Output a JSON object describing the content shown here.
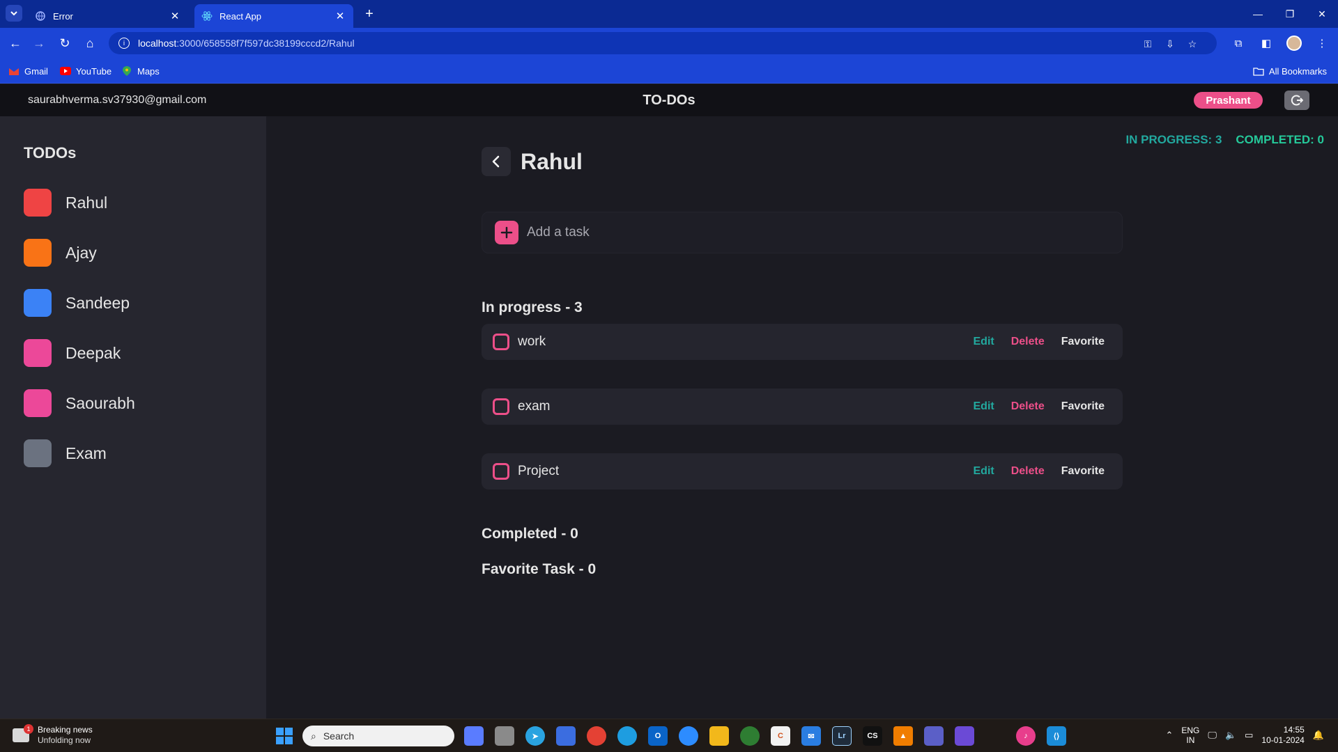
{
  "browser": {
    "tabs": [
      {
        "title": "Error",
        "active": false
      },
      {
        "title": "React App",
        "active": true
      }
    ],
    "url_host": "localhost",
    "url_path": ":3000/658558f7f597dc38199cccd2/Rahul",
    "bookmarks": [
      "Gmail",
      "YouTube",
      "Maps"
    ],
    "all_bookmarks": "All Bookmarks"
  },
  "header": {
    "email": "saurabhverma.sv37930@gmail.com",
    "title": "TO-DOs",
    "user_name": "Prashant"
  },
  "sidebar": {
    "title": "TODOs",
    "items": [
      {
        "label": "Rahul",
        "color": "#ef4444"
      },
      {
        "label": "Ajay",
        "color": "#f97316"
      },
      {
        "label": "Sandeep",
        "color": "#3b82f6"
      },
      {
        "label": "Deepak",
        "color": "#ec4899"
      },
      {
        "label": "Saourabh",
        "color": "#ec4899"
      },
      {
        "label": "Exam",
        "color": "#6b7280"
      }
    ]
  },
  "stats": {
    "in_progress_label": "IN PROGRESS:",
    "in_progress_count": "3",
    "completed_label": "COMPLETED:",
    "completed_count": "0"
  },
  "main": {
    "list_title": "Rahul",
    "add_task_placeholder": "Add a task",
    "in_progress_header": "In progress - 3",
    "completed_header": "Completed - 0",
    "favorite_header": "Favorite Task - 0",
    "tasks": [
      {
        "label": "work",
        "edit": "Edit",
        "delete": "Delete",
        "favorite": "Favorite"
      },
      {
        "label": "exam",
        "edit": "Edit",
        "delete": "Delete",
        "favorite": "Favorite"
      },
      {
        "label": "Project",
        "edit": "Edit",
        "delete": "Delete",
        "favorite": "Favorite"
      }
    ]
  },
  "taskbar": {
    "news_title": "Breaking news",
    "news_sub": "Unfolding now",
    "news_badge": "1",
    "search_placeholder": "Search",
    "lang_1": "ENG",
    "lang_2": "IN",
    "time": "14:55",
    "date": "10-01-2024"
  },
  "colors": {
    "accent_pink": "#ec4f89",
    "accent_teal": "#22a99f",
    "browser_blue": "#1c45d6"
  }
}
